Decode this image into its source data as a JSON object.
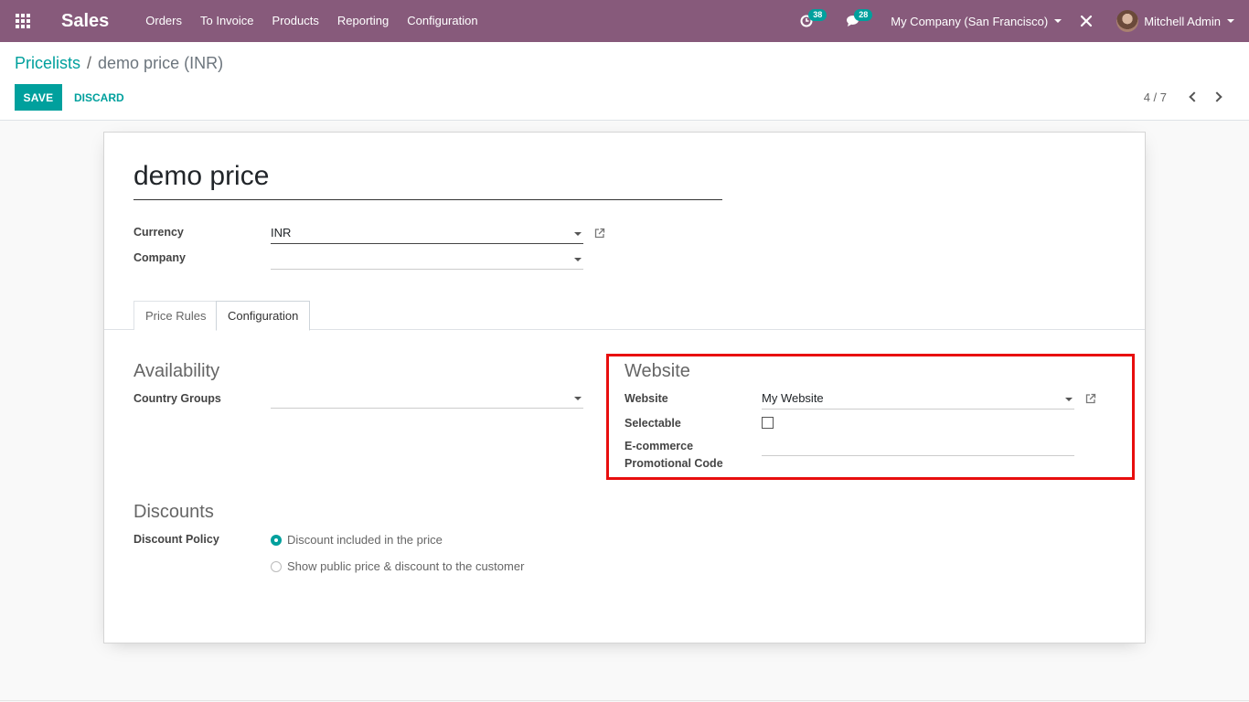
{
  "navbar": {
    "app_name": "Sales",
    "menu": [
      "Orders",
      "To Invoice",
      "Products",
      "Reporting",
      "Configuration"
    ],
    "activity_count": "38",
    "messages_count": "28",
    "company": "My Company (San Francisco)",
    "user": "Mitchell Admin",
    "accent_color": "#875a7b"
  },
  "breadcrumb": {
    "parent": "Pricelists",
    "separator": "/",
    "current": "demo price (INR)"
  },
  "actions": {
    "save": "SAVE",
    "discard": "DISCARD"
  },
  "pager": {
    "counter": "4 / 7"
  },
  "form": {
    "name": "demo price",
    "currency_label": "Currency",
    "currency_value": "INR",
    "company_label": "Company",
    "company_value": ""
  },
  "tabs": [
    "Price Rules",
    "Configuration"
  ],
  "availability": {
    "title": "Availability",
    "country_groups_label": "Country Groups",
    "country_groups_value": ""
  },
  "website": {
    "title": "Website",
    "website_label": "Website",
    "website_value": "My Website",
    "selectable_label": "Selectable",
    "promo_label_line1": "E-commerce",
    "promo_label_line2": "Promotional Code",
    "promo_value": ""
  },
  "discounts": {
    "title": "Discounts",
    "policy_label": "Discount Policy",
    "option_1": "Discount included in the price",
    "option_2": "Show public price & discount to the customer"
  }
}
